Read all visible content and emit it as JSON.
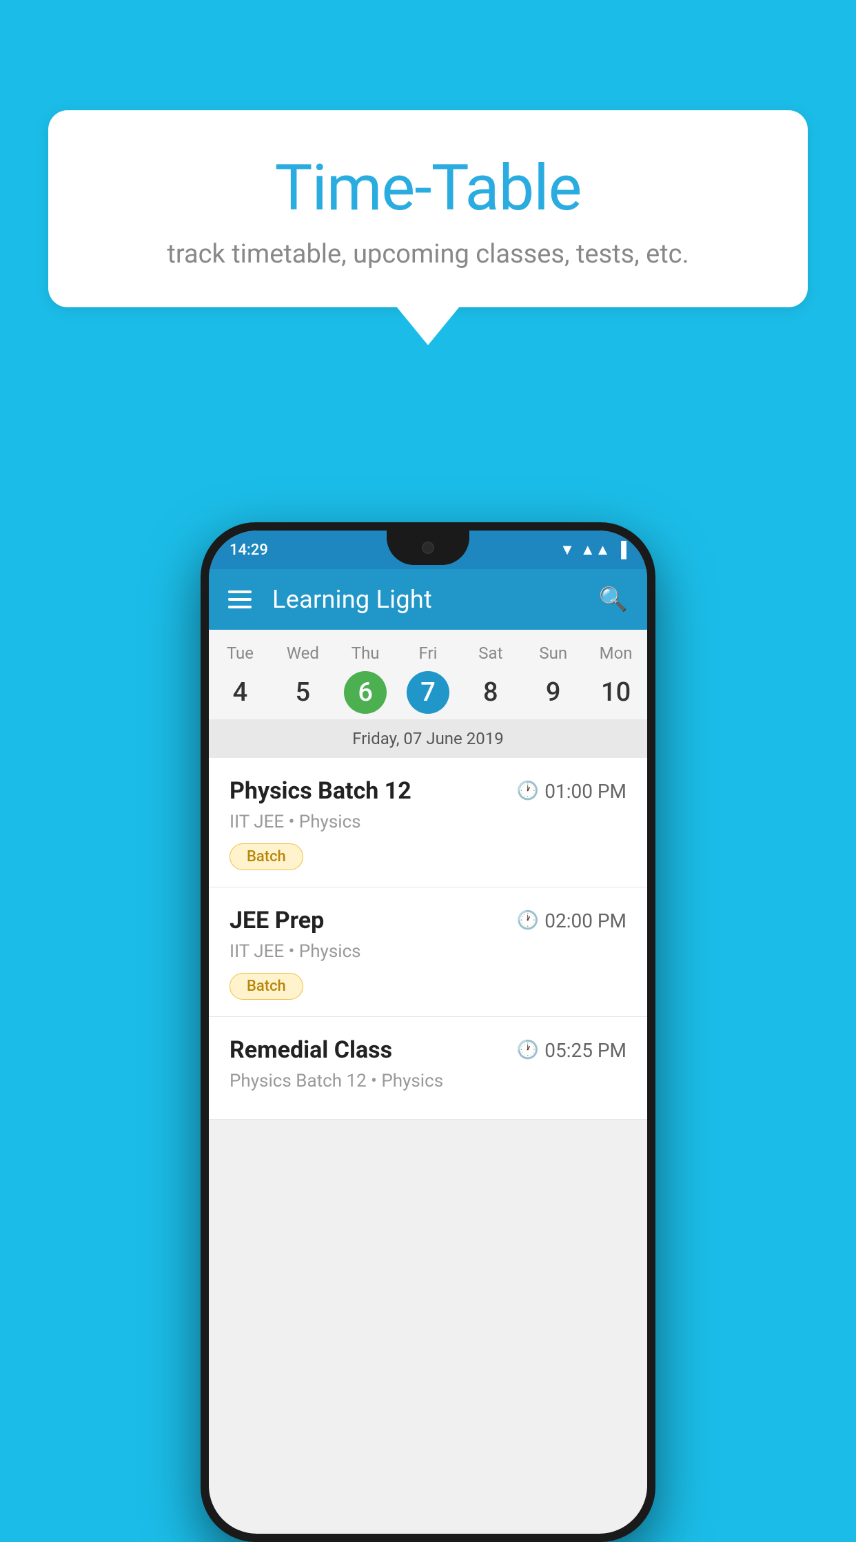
{
  "background": {
    "color": "#1BBDE8"
  },
  "speechBubble": {
    "title": "Time-Table",
    "subtitle": "track timetable, upcoming classes, tests, etc."
  },
  "appBar": {
    "title": "Learning Light",
    "menuIcon": "≡",
    "searchIcon": "🔍"
  },
  "statusBar": {
    "time": "14:29"
  },
  "calendar": {
    "selectedDate": "Friday, 07 June 2019",
    "days": [
      {
        "name": "Tue",
        "num": "4",
        "state": "normal"
      },
      {
        "name": "Wed",
        "num": "5",
        "state": "normal"
      },
      {
        "name": "Thu",
        "num": "6",
        "state": "today"
      },
      {
        "name": "Fri",
        "num": "7",
        "state": "selected"
      },
      {
        "name": "Sat",
        "num": "8",
        "state": "normal"
      },
      {
        "name": "Sun",
        "num": "9",
        "state": "normal"
      },
      {
        "name": "Mon",
        "num": "10",
        "state": "normal"
      }
    ]
  },
  "classes": [
    {
      "name": "Physics Batch 12",
      "time": "01:00 PM",
      "meta": "IIT JEE • Physics",
      "badge": "Batch"
    },
    {
      "name": "JEE Prep",
      "time": "02:00 PM",
      "meta": "IIT JEE • Physics",
      "badge": "Batch"
    },
    {
      "name": "Remedial Class",
      "time": "05:25 PM",
      "meta": "Physics Batch 12 • Physics",
      "badge": ""
    }
  ]
}
